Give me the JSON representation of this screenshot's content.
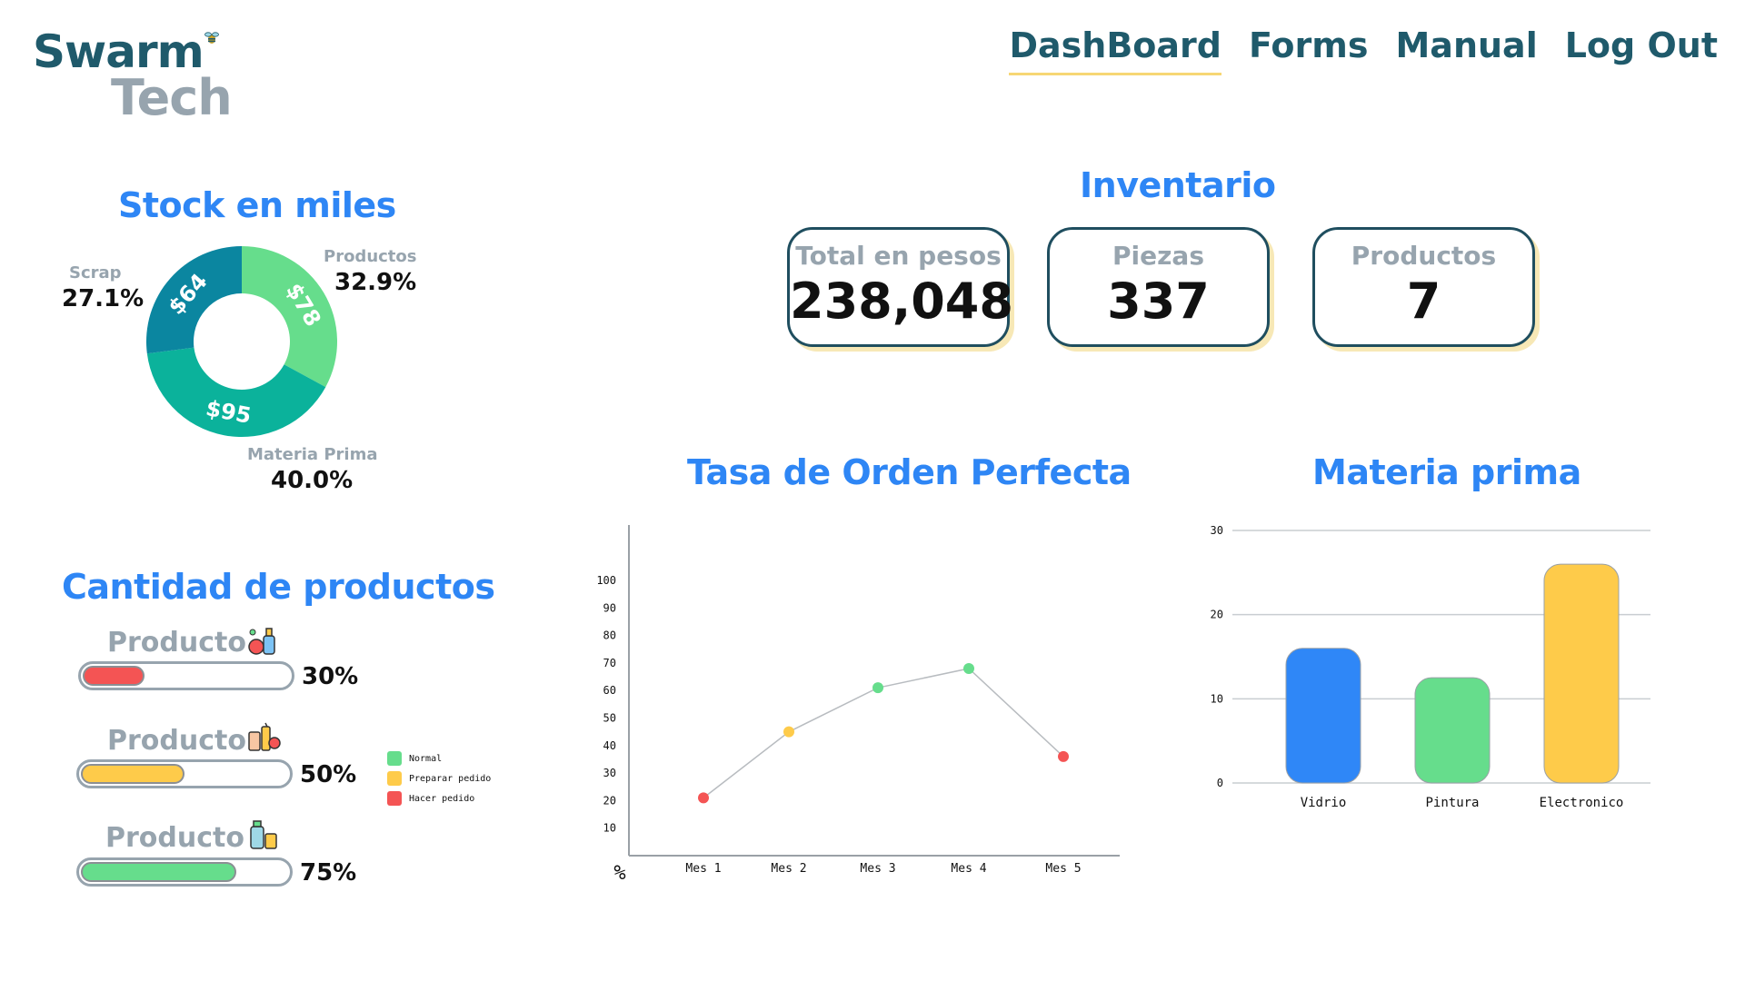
{
  "logo": {
    "line1": "Swarm",
    "line2": "Tech"
  },
  "nav": {
    "items": [
      "DashBoard",
      "Forms",
      "Manual",
      "Log Out"
    ],
    "active": "DashBoard"
  },
  "stock": {
    "title": "Stock en miles",
    "segments": [
      {
        "name": "Productos",
        "value_label": "$78",
        "percent": "32.9%",
        "color": "#66dd8c"
      },
      {
        "name": "Materia Prima",
        "value_label": "$95",
        "percent": "40.0%",
        "color": "#0bb29b"
      },
      {
        "name": "Scrap",
        "value_label": "$64",
        "percent": "27.1%",
        "color": "#0b86a0"
      }
    ]
  },
  "inventario": {
    "title": "Inventario",
    "cards": [
      {
        "label": "Total en pesos",
        "value": "238,048"
      },
      {
        "label": "Piezas",
        "value": "337"
      },
      {
        "label": "Productos",
        "value": "7"
      }
    ]
  },
  "productos": {
    "title": "Cantidad de productos",
    "items": [
      {
        "label": "Producto",
        "percent_label": "30%",
        "fill_fraction": 0.3,
        "status": "Hacer pedido",
        "color": "#f45454"
      },
      {
        "label": "Producto",
        "percent_label": "50%",
        "fill_fraction": 0.5,
        "status": "Preparar pedido",
        "color": "#fecb4a"
      },
      {
        "label": "Producto",
        "percent_label": "75%",
        "fill_fraction": 0.75,
        "status": "Normal",
        "color": "#66dd8c"
      }
    ],
    "legend": [
      {
        "label": "Normal",
        "color": "#66dd8c"
      },
      {
        "label": "Preparar pedido",
        "color": "#fecb4a"
      },
      {
        "label": "Hacer pedido",
        "color": "#f45454"
      }
    ]
  },
  "chart_data": [
    {
      "type": "pie",
      "title": "Stock en miles",
      "categories": [
        "Productos",
        "Materia Prima",
        "Scrap"
      ],
      "values": [
        78,
        95,
        64
      ],
      "value_labels": [
        "$78",
        "$95",
        "$64"
      ],
      "percents": [
        32.9,
        40.0,
        27.1
      ]
    },
    {
      "type": "line",
      "title": "Tasa de Orden Perfecta",
      "x": [
        "Mes 1",
        "Mes 2",
        "Mes 3",
        "Mes 4",
        "Mes 5"
      ],
      "values": [
        21,
        45,
        61,
        68,
        36
      ],
      "point_colors": [
        "#f45454",
        "#fecb4a",
        "#66dd8c",
        "#66dd8c",
        "#f45454"
      ],
      "ylabel": "%",
      "yticks": [
        "10",
        "20",
        "30",
        "40",
        "50",
        "60",
        "70",
        "80",
        "90",
        "100"
      ],
      "ylim": [
        0,
        110
      ],
      "line_color": "#b8bcc0"
    },
    {
      "type": "bar",
      "title": "Materia prima",
      "categories": [
        "Vidrio",
        "Pintura",
        "Electronico"
      ],
      "values": [
        16,
        12.5,
        26
      ],
      "colors": [
        "#2f87f7",
        "#66dd8c",
        "#fecb4a"
      ],
      "yticks": [
        "0",
        "10",
        "20",
        "30"
      ],
      "ylim": [
        0,
        30
      ],
      "grid": true
    }
  ]
}
